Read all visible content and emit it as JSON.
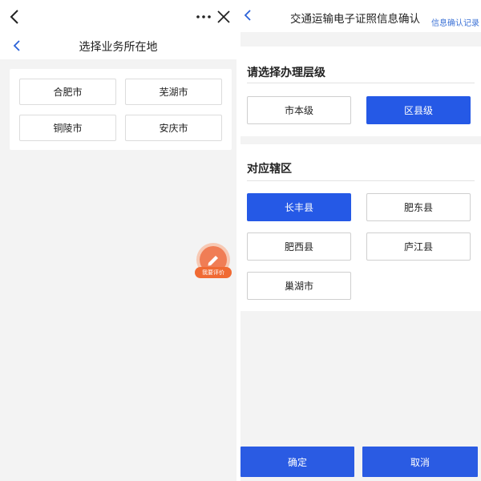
{
  "left": {
    "title": "选择业务所在地",
    "cities": [
      "合肥市",
      "芜湖市",
      "铜陵市",
      "安庆市"
    ],
    "fab_label": "我要评价"
  },
  "right": {
    "title": "交通运输电子证照信息确认",
    "records_link": "信息确认记录",
    "level_section": {
      "heading": "请选择办理层级",
      "options": [
        "市本级",
        "区县级"
      ],
      "selected": "区县级"
    },
    "district_section": {
      "heading": "对应辖区",
      "options": [
        "长丰县",
        "肥东县",
        "肥西县",
        "庐江县",
        "巢湖市"
      ],
      "selected": "长丰县"
    },
    "confirm_label": "确定",
    "cancel_label": "取消"
  },
  "colors": {
    "primary": "#2559e6",
    "accent_orange": "#f06a33",
    "link": "#3d73d6"
  }
}
